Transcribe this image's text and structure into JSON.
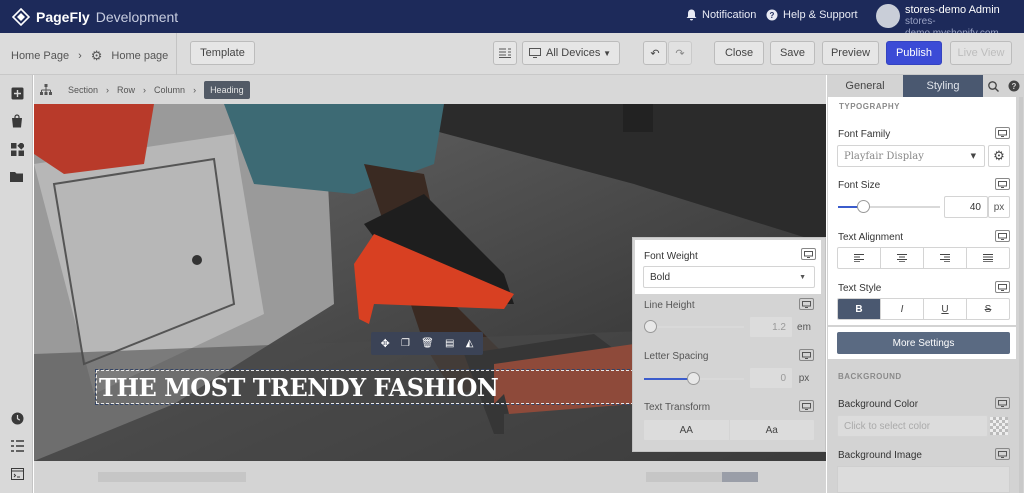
{
  "topbar": {
    "logo_brand": "PageFly",
    "logo_env": "Development",
    "notification_label": "Notification",
    "help_label": "Help & Support",
    "user_name": "stores-demo Admin",
    "user_store": "stores-demo.myshopify.com"
  },
  "toolbar": {
    "breadcrumb_home": "Home Page",
    "page_name": "Home page",
    "template_label": "Template",
    "devices_label": "All Devices",
    "close_label": "Close",
    "save_label": "Save",
    "preview_label": "Preview",
    "publish_label": "Publish",
    "live_view_label": "Live View"
  },
  "breadcrumb": {
    "items": [
      "Section",
      "Row",
      "Column",
      "Heading"
    ]
  },
  "canvas": {
    "heading_text": "THE MOST TRENDY FASHION"
  },
  "floating_panel": {
    "font_weight_label": "Font Weight",
    "font_weight_value": "Bold",
    "line_height_label": "Line Height",
    "line_height_value": "1.2",
    "line_height_unit": "em",
    "letter_spacing_label": "Letter Spacing",
    "letter_spacing_value": "0",
    "letter_spacing_unit": "px",
    "text_transform_label": "Text Transform",
    "transform_options": [
      "AA",
      "Aa"
    ]
  },
  "right_panel": {
    "tab_general": "General",
    "tab_styling": "Styling",
    "typography_header": "TYPOGRAPHY",
    "font_family_label": "Font Family",
    "font_family_value": "Playfair Display",
    "font_size_label": "Font Size",
    "font_size_value": "40",
    "font_size_unit": "px",
    "text_alignment_label": "Text Alignment",
    "text_style_label": "Text Style",
    "text_style_buttons": [
      "B",
      "I",
      "U",
      "S"
    ],
    "more_settings_label": "More Settings",
    "background_header": "BACKGROUND",
    "background_color_label": "Background Color",
    "background_color_placeholder": "Click to select color",
    "background_image_label": "Background Image"
  },
  "colors": {
    "topbar": "#1d2a5a",
    "publish": "#3b4bd6",
    "more_settings": "#5a6a82",
    "active_style": "#4a5870",
    "slider": "#3b5ccc"
  }
}
